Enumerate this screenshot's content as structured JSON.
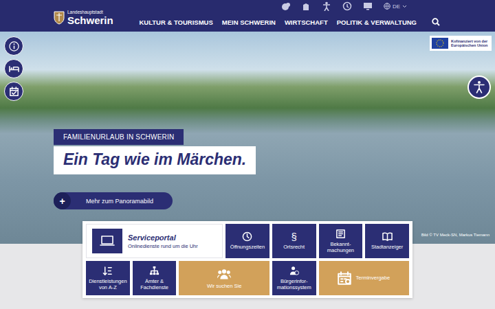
{
  "header": {
    "language": "DE"
  },
  "logo": {
    "small": "Landeshauptstadt",
    "name": "Schwerin"
  },
  "nav": [
    {
      "label": "KULTUR & TOURISMUS"
    },
    {
      "label": "MEIN SCHWERIN"
    },
    {
      "label": "WIRTSCHAFT"
    },
    {
      "label": "POLITIK & VERWALTUNG"
    }
  ],
  "hero": {
    "kicker": "FAMILIENURLAUB IN SCHWERIN",
    "title": "Ein Tag wie im Märchen.",
    "button": {
      "icon": "+",
      "label": "Mehr zum Panoramabild"
    },
    "credit": "Bild © TV Meck-SN, Markus Tiemann"
  },
  "eu_badge": {
    "text": "Kofinanziert von der Europäischen Union"
  },
  "service": {
    "portal": {
      "title": "Serviceportal",
      "subtitle": "Onlinedienste rund um die Uhr"
    },
    "tiles": [
      {
        "label": "Öffnungszeiten",
        "kind": "navy",
        "glyph": ""
      },
      {
        "label": "Ortsrecht",
        "kind": "navy",
        "glyph": "§"
      },
      {
        "label": "Bekannt-machungen",
        "kind": "navy",
        "glyph": ""
      },
      {
        "label": "Stadtanzeiger",
        "kind": "navy",
        "glyph": ""
      },
      {
        "label": "Dienstleistungen von A-Z",
        "kind": "navy",
        "glyph": ""
      },
      {
        "label": "Ämter & Fachdienste",
        "kind": "navy",
        "glyph": ""
      },
      {
        "label": "Wir suchen Sie",
        "kind": "gold",
        "glyph": ""
      },
      {
        "label": "Bürgerinfor-mationssystem",
        "kind": "navy",
        "glyph": ""
      },
      {
        "label": "Terminvergabe",
        "kind": "gold",
        "glyph": ""
      }
    ]
  }
}
